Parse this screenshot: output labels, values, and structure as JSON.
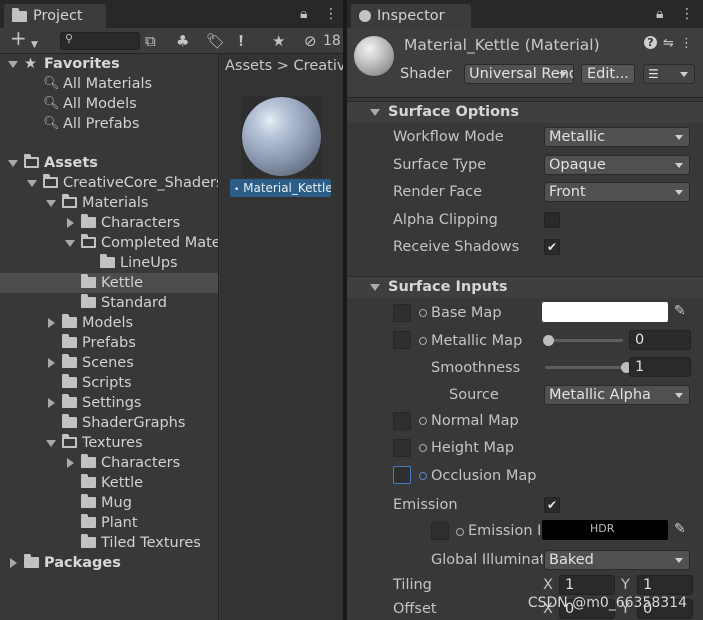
{
  "project": {
    "tab_title": "Project",
    "lock_icon": "lock-icon",
    "menu_icon": "kebab-menu-icon",
    "toolbar": {
      "add_icon": "+",
      "hidden_count": "18"
    },
    "tree": [
      {
        "label": "Favorites",
        "depth": 0,
        "icon": "star-icon",
        "expanded": true,
        "bold": true
      },
      {
        "label": "All Materials",
        "depth": 1,
        "icon": "search-icon"
      },
      {
        "label": "All Models",
        "depth": 1,
        "icon": "search-icon"
      },
      {
        "label": "All Prefabs",
        "depth": 1,
        "icon": "search-icon"
      },
      {
        "label": "Assets",
        "depth": 0,
        "icon": "folder-open-icon",
        "expanded": true,
        "bold": true
      },
      {
        "label": "CreativeCore_Shaders",
        "depth": 1,
        "icon": "folder-open-icon",
        "expanded": true
      },
      {
        "label": "Materials",
        "depth": 2,
        "icon": "folder-open-icon",
        "expanded": true
      },
      {
        "label": "Characters",
        "depth": 3,
        "icon": "folder-icon",
        "collapsed": true
      },
      {
        "label": "Completed Materials",
        "depth": 3,
        "icon": "folder-open-icon",
        "expanded": true
      },
      {
        "label": "LineUps",
        "depth": 4,
        "icon": "folder-icon"
      },
      {
        "label": "Kettle",
        "depth": 3,
        "icon": "folder-icon",
        "selected": true
      },
      {
        "label": "Standard",
        "depth": 3,
        "icon": "folder-icon"
      },
      {
        "label": "Models",
        "depth": 2,
        "icon": "folder-icon",
        "collapsed": true
      },
      {
        "label": "Prefabs",
        "depth": 2,
        "icon": "folder-icon"
      },
      {
        "label": "Scenes",
        "depth": 2,
        "icon": "folder-icon",
        "collapsed": true
      },
      {
        "label": "Scripts",
        "depth": 2,
        "icon": "folder-icon"
      },
      {
        "label": "Settings",
        "depth": 2,
        "icon": "folder-icon",
        "collapsed": true
      },
      {
        "label": "ShaderGraphs",
        "depth": 2,
        "icon": "folder-icon"
      },
      {
        "label": "Textures",
        "depth": 2,
        "icon": "folder-open-icon",
        "expanded": true
      },
      {
        "label": "Characters",
        "depth": 3,
        "icon": "folder-icon",
        "collapsed": true
      },
      {
        "label": "Kettle",
        "depth": 3,
        "icon": "folder-icon"
      },
      {
        "label": "Mug",
        "depth": 3,
        "icon": "folder-icon"
      },
      {
        "label": "Plant",
        "depth": 3,
        "icon": "folder-icon"
      },
      {
        "label": "Tiled Textures",
        "depth": 3,
        "icon": "folder-icon"
      },
      {
        "label": "Packages",
        "depth": 0,
        "icon": "folder-icon",
        "collapsed": true,
        "bold": true
      }
    ],
    "breadcrumb": "Assets > CreativeCore_Shaders > Materials > Kettle",
    "asset_label": "Material_Kettle"
  },
  "inspector": {
    "tab_title": "Inspector",
    "material_title": "Material_Kettle (Material)",
    "shader_label": "Shader",
    "shader_value": "Universal Render Pipeline/Lit",
    "edit_button": "Edit...",
    "help_icon": "?",
    "surface_options": {
      "title": "Surface Options",
      "workflow_label": "Workflow Mode",
      "workflow_value": "Metallic",
      "surface_type_label": "Surface Type",
      "surface_type_value": "Opaque",
      "render_face_label": "Render Face",
      "render_face_value": "Front",
      "alpha_clipping_label": "Alpha Clipping",
      "alpha_clipping_checked": false,
      "receive_shadows_label": "Receive Shadows",
      "receive_shadows_checked": true
    },
    "surface_inputs": {
      "title": "Surface Inputs",
      "base_map_label": "Base Map",
      "base_color": "#ffffff",
      "metallic_map_label": "Metallic Map",
      "metallic_value": "0",
      "metallic_fraction": 0.0,
      "smoothness_label": "Smoothness",
      "smoothness_value": "1",
      "smoothness_fraction": 1.0,
      "source_label": "Source",
      "source_value": "Metallic Alpha",
      "normal_map_label": "Normal Map",
      "height_map_label": "Height Map",
      "occlusion_map_label": "Occlusion Map",
      "emission_label": "Emission",
      "emission_checked": true,
      "emission_map_label": "Emission Map",
      "emission_color": "#000000",
      "hdr_label": "HDR",
      "gi_label": "Global Illumination",
      "gi_value": "Baked",
      "tiling_label": "Tiling",
      "tiling_x": "1",
      "tiling_y": "1",
      "offset_label": "Offset",
      "offset_x": "0",
      "offset_y": "0",
      "x_label": "X",
      "y_label": "Y"
    }
  },
  "watermark": "CSDN @m0_66358314"
}
